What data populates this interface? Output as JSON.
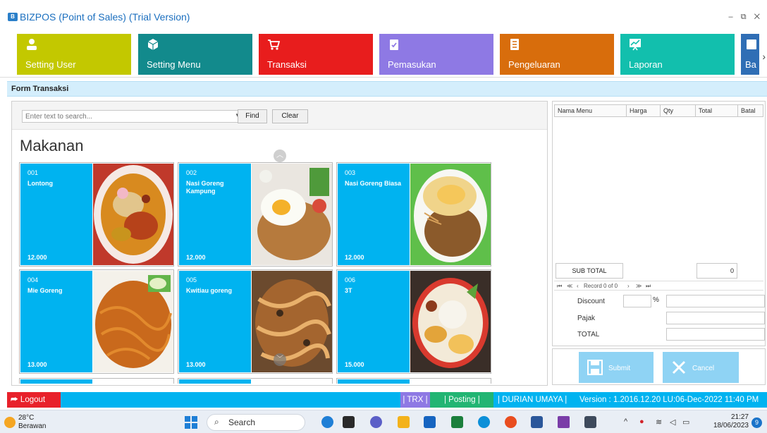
{
  "window": {
    "app_icon": "B",
    "title": "BIZPOS (Point of Sales) (Trial Version)",
    "controls": "– ⧉ ✕"
  },
  "ribbon": {
    "tiles": [
      {
        "label": "Setting User",
        "icon": "user-icon",
        "color": "#c3c800"
      },
      {
        "label": "Setting Menu",
        "icon": "box-icon",
        "color": "#128a8c"
      },
      {
        "label": "Transaksi",
        "icon": "cart-icon",
        "color": "#e81d1d"
      },
      {
        "label": "Pemasukan",
        "icon": "checklist-icon",
        "color": "#8e79e4"
      },
      {
        "label": "Pengeluaran",
        "icon": "ledger-icon",
        "color": "#d86d0c"
      },
      {
        "label": "Laporan",
        "icon": "chart-icon",
        "color": "#12bfad"
      },
      {
        "label": "Ba",
        "icon": "backup-icon",
        "color": "#2f6eb5"
      }
    ],
    "more_arrow": "›"
  },
  "form": {
    "title": "Form Transaksi"
  },
  "search": {
    "placeholder": "Enter text to search...",
    "find_label": "Find",
    "clear_label": "Clear"
  },
  "category": {
    "title": "Makanan"
  },
  "menu_items": [
    {
      "code": "001",
      "name": "Lontong",
      "price": "12.000"
    },
    {
      "code": "002",
      "name": "Nasi Goreng Kampung",
      "price": "12.000"
    },
    {
      "code": "003",
      "name": "Nasi Goreng Biasa",
      "price": "12.000"
    },
    {
      "code": "004",
      "name": "Mie Goreng",
      "price": "13.000"
    },
    {
      "code": "005",
      "name": "Kwitiau goreng",
      "price": "13.000"
    },
    {
      "code": "006",
      "name": "3T",
      "price": "15.000"
    }
  ],
  "order_grid": {
    "columns": [
      "Nama Menu",
      "Harga",
      "Qty",
      "Total",
      "Batal"
    ],
    "subtotal_label": "SUB TOTAL",
    "subtotal_value": "0",
    "navigator": {
      "first": "⏮",
      "prev_page": "≪",
      "prev": "‹",
      "record_text": "Record 0 of 0",
      "next": "›",
      "next_page": "≫",
      "last": "⏭"
    }
  },
  "calc": {
    "discount_label": "Discount",
    "percent_sign": "%",
    "tax_label": "Pajak",
    "total_label": "TOTAL"
  },
  "actions": {
    "submit_label": "Submit",
    "cancel_label": "Cancel"
  },
  "statusbar": {
    "logout_label": "Logout",
    "trx": "| TRX |",
    "posting": "| Posting |",
    "user": "| DURIAN UMAYA |",
    "version": "Version : 1.2016.12.20 LU:06-Dec-2022 11:40 PM",
    "colors": {
      "trx": "#8e79e4",
      "posting": "#22b573"
    }
  },
  "taskbar": {
    "temperature": "28°C",
    "weather": "Berawan",
    "search_label": "Search",
    "tray_arrow": "^",
    "time": "21:27",
    "date": "18/06/2023",
    "notifications": "9"
  }
}
